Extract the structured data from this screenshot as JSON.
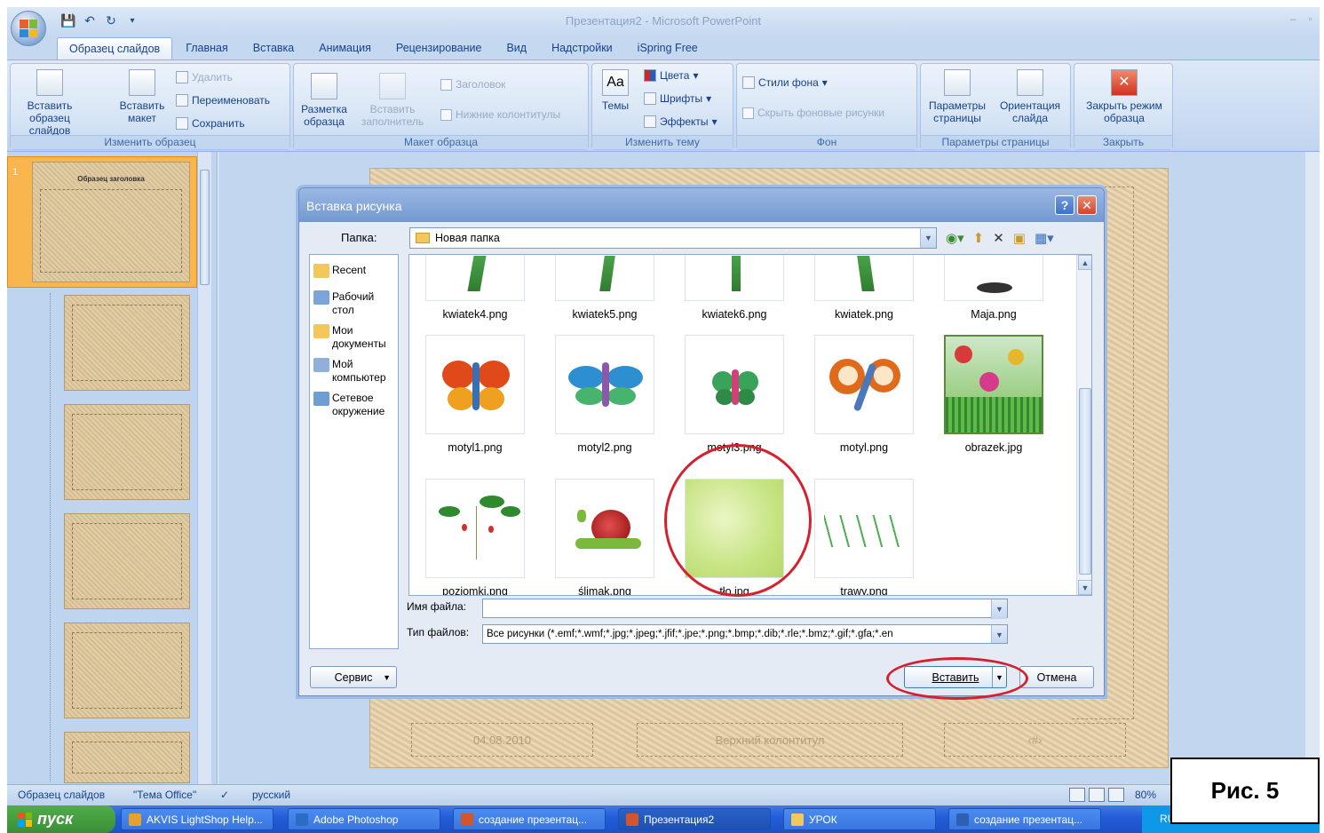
{
  "window": {
    "title": "Презентация2 - Microsoft PowerPoint"
  },
  "ribbon": {
    "tabs": [
      "Образец слайдов",
      "Главная",
      "Вставка",
      "Анимация",
      "Рецензирование",
      "Вид",
      "Надстройки",
      "iSpring Free"
    ],
    "groups": {
      "edit_master": {
        "label": "Изменить образец",
        "insert_master": "Вставить образец слайдов",
        "insert_layout": "Вставить макет",
        "delete": "Удалить",
        "rename": "Переименовать",
        "save": "Сохранить"
      },
      "master_layout": {
        "label": "Макет образца",
        "master_layout": "Разметка образца",
        "insert_placeholder": "Вставить заполнитель",
        "title": "Заголовок",
        "footers": "Нижние колонтитулы"
      },
      "edit_theme": {
        "label": "Изменить тему",
        "themes": "Темы",
        "colors": "Цвета",
        "fonts": "Шрифты",
        "effects": "Эффекты"
      },
      "background": {
        "label": "Фон",
        "styles": "Стили фона",
        "hide": "Скрыть фоновые рисунки"
      },
      "page_setup": {
        "label": "Параметры страницы",
        "setup": "Параметры страницы",
        "orientation": "Ориентация слайда"
      },
      "close": {
        "label": "Закрыть",
        "close_master": "Закрыть режим образца"
      }
    }
  },
  "slides_panel": {
    "first_number": "1",
    "first_title": "Образец заголовка"
  },
  "main_slide": {
    "date": "04.08.2010",
    "footer": "Верхний колонтитул",
    "number": "‹#›"
  },
  "dialog": {
    "title": "Вставка рисунка",
    "folder_label": "Папка:",
    "folder_value": "Новая папка",
    "places": [
      "Recent",
      "Рабочий стол",
      "Мои документы",
      "Мой компьютер",
      "Сетевое окружение"
    ],
    "files_row1": [
      "kwiatek4.png",
      "kwiatek5.png",
      "kwiatek6.png",
      "kwiatek.png",
      "Maja.png"
    ],
    "files_row2": [
      "motyl1.png",
      "motyl2.png",
      "motyl3.png",
      "motyl.png",
      "obrazek.jpg"
    ],
    "files_row3": [
      "poziomki.png",
      "ślimak.png",
      "tło.jpg",
      "trawy.png"
    ],
    "filename_label": "Имя файла:",
    "filename_value": "",
    "filetype_label": "Тип файлов:",
    "filetype_value": "Все рисунки (*.emf;*.wmf;*.jpg;*.jpeg;*.jfif;*.jpe;*.png;*.bmp;*.dib;*.rle;*.bmz;*.gif;*.gfa;*.en",
    "service_button": "Сервис",
    "insert_button": "Вставить",
    "cancel_button": "Отмена"
  },
  "statusbar": {
    "mode": "Образец слайдов",
    "theme": "\"Тема Office\"",
    "language": "русский",
    "zoom": "80%"
  },
  "taskbar": {
    "start": "пуск",
    "tasks": [
      "AKVIS LightShop Help...",
      "Adobe Photoshop",
      "создание презентац...",
      "Презентация2",
      "УРОК",
      "создание презентац..."
    ],
    "lang": "RU"
  },
  "caption": "Рис. 5",
  "colors": {
    "highlight": "#d6202d",
    "ribbon": "#c9dbf2",
    "selected_slide": "#f9b64f"
  }
}
